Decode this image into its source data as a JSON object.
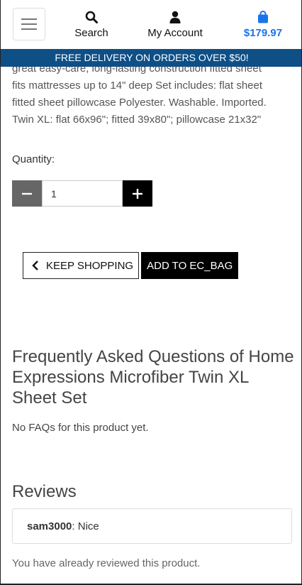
{
  "header": {
    "search_label": "Search",
    "account_label": "My Account",
    "cart_total": "$179.97",
    "accent_color": "#1a73e8"
  },
  "banner": {
    "text": "FREE DELIVERY ON ORDERS OVER $50!",
    "color": "#0e4f86"
  },
  "product": {
    "description_lines": [
      "great easy-care, long-lasting construction fitted sheet",
      "fits mattresses up to 14\" deep Set includes: flat sheet",
      "fitted sheet pillowcase Polyester. Washable. Imported.",
      "Twin XL: flat 66x96\"; fitted 39x80\"; pillowcase 21x32\""
    ]
  },
  "quantity": {
    "label": "Quantity:",
    "value": "1",
    "minus_icon": "minus-icon",
    "plus_icon": "plus-icon"
  },
  "actions": {
    "keep_shopping": "KEEP SHOPPING",
    "add_to_bag": "ADD TO EC_BAG"
  },
  "faq": {
    "title": "Frequently Asked Questions of Home Expressions Microfiber Twin XL Sheet Set",
    "empty_text": "No FAQs for this product yet."
  },
  "reviews": {
    "title": "Reviews",
    "items": [
      {
        "author": "sam3000",
        "text": ": Nice"
      }
    ],
    "note": "You have already reviewed this product."
  }
}
